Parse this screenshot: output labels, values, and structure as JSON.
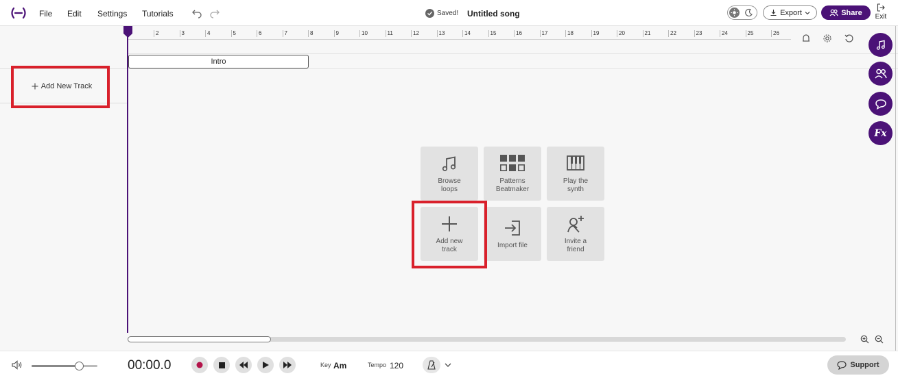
{
  "app": {
    "logo_icon": "bandlab-logo-icon",
    "brand_color": "#4b1277",
    "highlight_color": "#d9202b"
  },
  "menu": {
    "items": [
      "File",
      "Edit",
      "Settings",
      "Tutorials"
    ]
  },
  "status": {
    "saved_label": "Saved!",
    "song_title": "Untitled song"
  },
  "header_actions": {
    "export_label": "Export",
    "share_label": "Share",
    "exit_label": "Exit"
  },
  "tracks": {
    "add_new_track_label": "Add New Track"
  },
  "ruler": {
    "bars": [
      "2",
      "3",
      "4",
      "5",
      "6",
      "7",
      "8",
      "9",
      "10",
      "11",
      "12",
      "13",
      "14",
      "15",
      "16",
      "17",
      "18",
      "19",
      "20",
      "21",
      "22",
      "23",
      "24",
      "25",
      "26"
    ]
  },
  "sections": [
    {
      "label": "Intro"
    }
  ],
  "side_tools": [
    "music-note-icon",
    "collaborators-icon",
    "chat-icon",
    "fx-icon"
  ],
  "side_tools_fx_label": "Fx",
  "quick_actions": [
    {
      "label_line1": "Browse",
      "label_line2": "loops",
      "icon": "music-note-icon"
    },
    {
      "label_line1": "Patterns",
      "label_line2": "Beatmaker",
      "icon": "grid-pads-icon"
    },
    {
      "label_line1": "Play the",
      "label_line2": "synth",
      "icon": "piano-keys-icon"
    },
    {
      "label_line1": "Add new",
      "label_line2": "track",
      "icon": "plus-icon"
    },
    {
      "label_line1": "Import file",
      "label_line2": "",
      "icon": "import-icon"
    },
    {
      "label_line1": "Invite a",
      "label_line2": "friend",
      "icon": "add-person-icon"
    }
  ],
  "transport": {
    "time": "00:00.0",
    "volume_level": 0.72,
    "key_label": "Key",
    "key_value": "Am",
    "tempo_label": "Tempo",
    "tempo_value": "120",
    "support_label": "Support"
  },
  "timeline": {
    "scroll_visible_fraction": 0.2
  }
}
